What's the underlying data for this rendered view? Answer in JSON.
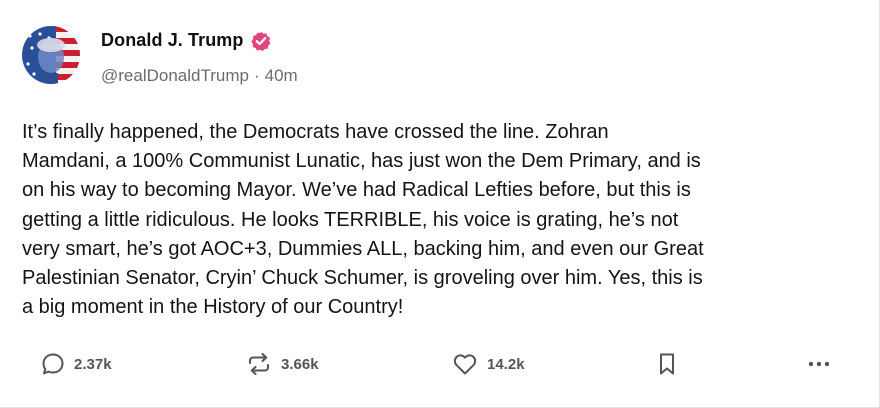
{
  "author": {
    "display_name": "Donald J. Trump",
    "handle": "@realDonaldTrump",
    "separator": "·",
    "time_ago": "40m",
    "verified_color": "#e0457b"
  },
  "post": {
    "lines": [
      "It’s finally happened, the Democrats have crossed the line. Zohran",
      "Mamdani, a 100% Communist Lunatic, has just won the Dem Primary, and is",
      "on his way to becoming Mayor. We’ve had Radical Lefties before, but this is",
      "getting a little ridiculous. He looks TERRIBLE, his voice is grating, he’s not",
      "very smart, he’s got AOC+3, Dummies ALL, backing him, and even our Great",
      "Palestinian Senator, Cryin’ Chuck Schumer, is groveling over him. Yes, this is",
      "a big moment in the History of our Country!"
    ]
  },
  "actions": {
    "replies": {
      "icon": "reply-icon",
      "count": "2.37k"
    },
    "retruths": {
      "icon": "repost-icon",
      "count": "3.66k"
    },
    "likes": {
      "icon": "heart-icon",
      "count": "14.2k"
    },
    "bookmark": {
      "icon": "bookmark-icon"
    },
    "more": {
      "icon": "more-icon"
    }
  }
}
